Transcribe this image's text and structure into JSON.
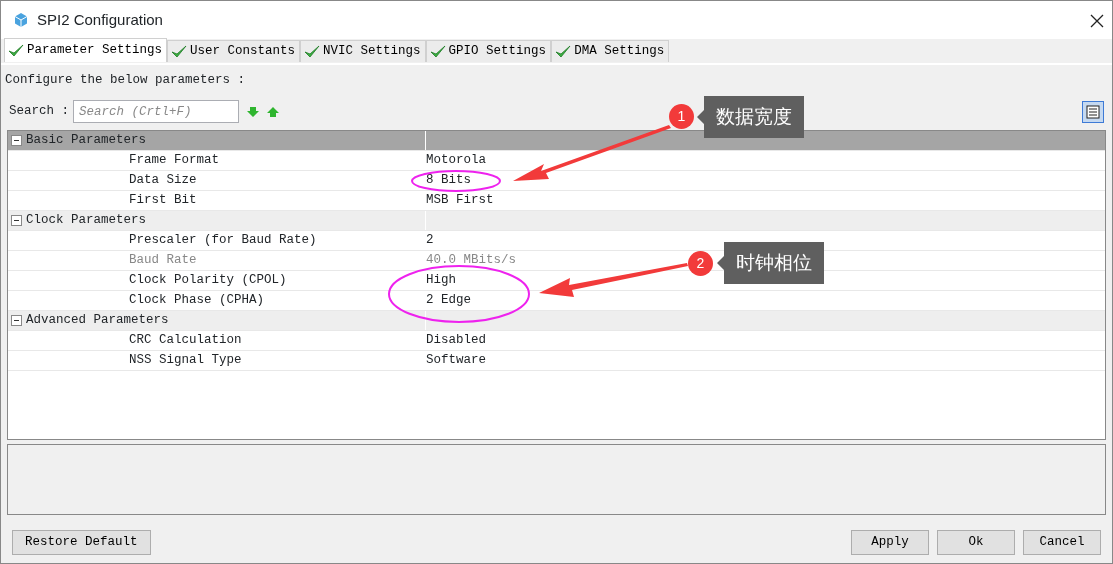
{
  "window": {
    "title": "SPI2 Configuration"
  },
  "tabs": [
    {
      "label": "Parameter Settings",
      "selected": true
    },
    {
      "label": "User Constants",
      "selected": false
    },
    {
      "label": "NVIC Settings",
      "selected": false
    },
    {
      "label": "GPIO Settings",
      "selected": false
    },
    {
      "label": "DMA Settings",
      "selected": false
    }
  ],
  "hint": "Configure the below parameters :",
  "search": {
    "label": "Search :",
    "placeholder": "Search (Crtl+F)"
  },
  "groups": [
    {
      "title": "Basic Parameters",
      "expanded": true,
      "selected": true,
      "children": [
        {
          "name": "Frame Format",
          "value": "Motorola",
          "disabled": false
        },
        {
          "name": "Data Size",
          "value": "8 Bits",
          "disabled": false
        },
        {
          "name": "First Bit",
          "value": "MSB First",
          "disabled": false
        }
      ]
    },
    {
      "title": "Clock Parameters",
      "expanded": true,
      "selected": false,
      "children": [
        {
          "name": "Prescaler (for Baud Rate)",
          "value": "2",
          "disabled": false
        },
        {
          "name": "Baud Rate",
          "value": "40.0 MBits/s",
          "disabled": true
        },
        {
          "name": "Clock Polarity (CPOL)",
          "value": "High",
          "disabled": false
        },
        {
          "name": "Clock Phase (CPHA)",
          "value": "2 Edge",
          "disabled": false
        }
      ]
    },
    {
      "title": "Advanced Parameters",
      "expanded": true,
      "selected": false,
      "children": [
        {
          "name": "CRC Calculation",
          "value": "Disabled",
          "disabled": false
        },
        {
          "name": "NSS Signal Type",
          "value": "Software",
          "disabled": false
        }
      ]
    }
  ],
  "buttons_left": [
    "Restore Default"
  ],
  "buttons_right": [
    "Apply",
    "Ok",
    "Cancel"
  ],
  "annotations": [
    {
      "number": "1",
      "label": "数据宽度"
    },
    {
      "number": "2",
      "label": "时钟相位"
    }
  ]
}
